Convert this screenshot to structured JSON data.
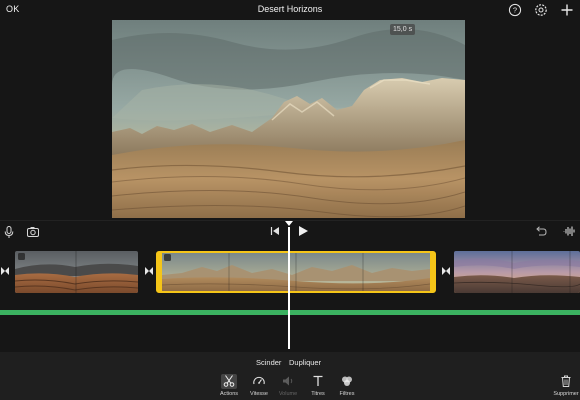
{
  "topbar": {
    "ok_label": "OK",
    "title": "Desert Horizons",
    "icons": [
      "help-icon",
      "settings-icon",
      "add-icon"
    ]
  },
  "preview": {
    "timecode": "15,0 s",
    "zoom_icon": "zoom-icon"
  },
  "timeline": {
    "left_icons": [
      "microphone-icon",
      "camera-icon"
    ],
    "transport": [
      "skip-to-start-icon",
      "play-icon"
    ],
    "right_icons": [
      "undo-icon",
      "audio-waveform-icon"
    ],
    "clips": [
      {
        "name": "clip-canyon",
        "selected": false
      },
      {
        "name": "clip-desert-horizons",
        "selected": true
      },
      {
        "name": "clip-sunset",
        "selected": false
      }
    ]
  },
  "colors": {
    "selection": "#f5c518",
    "audio_track": "#3bb160",
    "background": "#161616"
  },
  "actions": {
    "split_label": "Scinder",
    "duplicate_label": "Dupliquer"
  },
  "toolbar": {
    "actions_label": "Actions",
    "speed_label": "Vitesse",
    "volume_label": "Volume",
    "titles_label": "Titres",
    "filters_label": "Filtres",
    "delete_label": "Supprimer"
  }
}
